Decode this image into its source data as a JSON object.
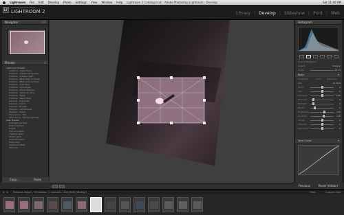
{
  "menubar": {
    "items": [
      "Lightroom",
      "File",
      "Edit",
      "Develop",
      "Photo",
      "Settings",
      "View",
      "Window",
      "Help"
    ],
    "window_title": "Lightroom 2 Catalog.lrcat - Adobe Photoshop Lightroom - Develop",
    "clock": "Sat 11:40 AM"
  },
  "identity": {
    "brand_small": "ADOBE PHOTOSHOP",
    "brand_large": "LIGHTROOM 2",
    "logo": "Lr"
  },
  "modules": {
    "library": "Library",
    "develop": "Develop",
    "slideshow": "Slideshow",
    "print": "Print",
    "web": "Web",
    "separator": "|"
  },
  "left": {
    "navigator": {
      "title": "Navigator",
      "zoom": "FIT"
    },
    "presets": {
      "title": "Presets",
      "plus": "+"
    },
    "preset_folders": [
      "Lightroom Presets",
      "User Presets"
    ],
    "preset_items": [
      "Creative - Aged Photo",
      "Creative - Antique Grayscale",
      "Creative - Antique Light",
      "Creative - B&W High Contrast",
      "Creative - B&W Low Contrast",
      "Creative - Cold Tone",
      "Creative - Cyanotype",
      "Creative - Direct Positive",
      "Creative - Selenium Tone",
      "Creative - Sepia",
      "Creative - Sepia Tone",
      "General - Grayscale",
      "General - Punch",
      "General - Zeroed",
      "Sharpen - Landscapes",
      "Sharpen - Faces",
      "Tone Curve - Flat",
      "Tone Curve - Strong Contrast"
    ],
    "user_presets": [
      "backlight portrait",
      "bleach bypass",
      "bright",
      "cold and warm",
      "creative sepia",
      "desert_glow",
      "dramatic black",
      "faded dark",
      "maximum B&W",
      "stark bw"
    ],
    "copy_label": "Copy...",
    "paste_label": "Paste"
  },
  "right": {
    "histogram_title": "Histogram",
    "sections": [
      {
        "label": "Basic",
        "toggle": "▾"
      },
      {
        "label": "Tone Curve",
        "toggle": "▾"
      }
    ],
    "crop_label": "Crop & Straighten",
    "aspect_label": "Aspect",
    "aspect_value": "Original",
    "angle_label": "Angle",
    "angle_value": "-19.12",
    "treatment": "Treatment",
    "color_label": "Color",
    "gray_label": "Grayscale",
    "wb_label": "WB",
    "wb_value": "As Shot",
    "sliders": [
      {
        "label": "Temp",
        "value": "0",
        "pos": 0.5
      },
      {
        "label": "Tint",
        "value": "0",
        "pos": 0.5
      },
      {
        "label": "Exposure",
        "value": "0.00",
        "pos": 0.5
      },
      {
        "label": "Recovery",
        "value": "0",
        "pos": 0.1
      },
      {
        "label": "Fill Light",
        "value": "0",
        "pos": 0.1
      },
      {
        "label": "Blacks",
        "value": "5",
        "pos": 0.15
      },
      {
        "label": "Brightness",
        "value": "+50",
        "pos": 0.6
      },
      {
        "label": "Contrast",
        "value": "+25",
        "pos": 0.55
      },
      {
        "label": "Clarity",
        "value": "0",
        "pos": 0.5
      },
      {
        "label": "Vibrance",
        "value": "0",
        "pos": 0.5
      },
      {
        "label": "Saturation",
        "value": "0",
        "pos": 0.5
      }
    ],
    "previous": "Previous",
    "reset": "Reset (Adobe)"
  },
  "filmbar": {
    "text": "Previous Import / 15 photos / 1 selected / 102_8142_08.dng ▾",
    "filter_label": "Filter:",
    "filter_value": "Custom Filter"
  },
  "colors": {
    "accent": "#ffffff",
    "panel": "#2f2f2f",
    "canvas": "#3f3f3f",
    "photo_pink": "#8a6a78"
  },
  "icons": [
    "apple-icon",
    "crop-icon",
    "spot-icon",
    "redeye-icon",
    "gradient-icon",
    "brush-icon",
    "grid-icon",
    "compare-icon",
    "nav-back-icon",
    "nav-forward-icon"
  ]
}
